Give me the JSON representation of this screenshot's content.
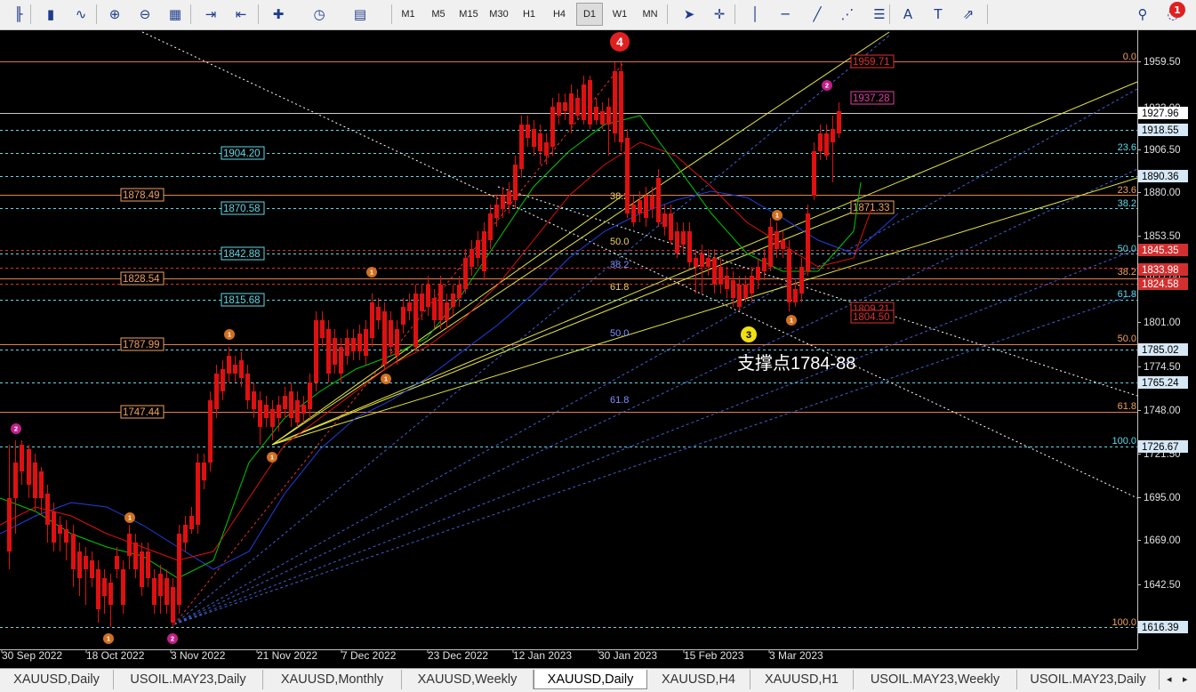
{
  "toolbar": {
    "periods": [
      "M1",
      "M5",
      "M15",
      "M30",
      "H1",
      "H4",
      "D1",
      "W1",
      "MN"
    ],
    "active_period": "D1",
    "notification_count": "1",
    "icons": [
      "bar-chart-icon",
      "candlestick-icon",
      "line-chart-icon",
      "zoom-in-icon",
      "zoom-out-icon",
      "tile-windows-icon",
      "autoscroll-icon",
      "chart-shift-icon",
      "new-order-icon",
      "clock-icon",
      "templates-icon",
      "cursor-icon",
      "crosshair-icon",
      "vertical-line-icon",
      "horizontal-line-icon",
      "trendline-icon",
      "fibonacci-fan-icon",
      "fibonacci-retracement-icon",
      "text-icon",
      "text-label-icon",
      "arrows-icon",
      "search-icon",
      "notification-icon"
    ]
  },
  "chart": {
    "annotation": "支撑点1784-88",
    "wave_labels_large": [
      "4",
      "3"
    ],
    "wave_labels_small": [
      "1",
      "2"
    ],
    "price_scale": [
      "1959.50",
      "1933.00",
      "1906.50",
      "1880.00",
      "1853.50",
      "1827.00",
      "1801.00",
      "1774.50",
      "1748.00",
      "1721.50",
      "1695.00",
      "1669.00",
      "1642.50",
      "1616.00"
    ],
    "price_tags": [
      {
        "text": "1927.96",
        "bg": "#ffffff",
        "fg": "#000000"
      },
      {
        "text": "1918.55",
        "bg": "#d6e7f5",
        "fg": "#000000"
      },
      {
        "text": "1890.36",
        "bg": "#d6e7f5",
        "fg": "#000000"
      },
      {
        "text": "1845.35",
        "bg": "#d32f2f",
        "fg": "#ffffff"
      },
      {
        "text": "1833.98",
        "bg": "#d32f2f",
        "fg": "#ffffff"
      },
      {
        "text": "1824.58",
        "bg": "#d32f2f",
        "fg": "#ffffff"
      },
      {
        "text": "1785.02",
        "bg": "#d6e7f5",
        "fg": "#000000"
      },
      {
        "text": "1765.24",
        "bg": "#d6e7f5",
        "fg": "#000000"
      },
      {
        "text": "1726.67",
        "bg": "#d6e7f5",
        "fg": "#000000"
      },
      {
        "text": "1616.39",
        "bg": "#d6e7f5",
        "fg": "#000000"
      }
    ],
    "left_level_labels": [
      "1904.20",
      "1878.49",
      "1870.58",
      "1842.88",
      "1828.54",
      "1815.68",
      "1787.99",
      "1747.44"
    ],
    "right_level_labels": [
      "1959.71",
      "1937.28",
      "1871.33",
      "1809.21",
      "1804.50"
    ],
    "fib_right": [
      "0.0",
      "23.6",
      "23.6",
      "38.2",
      "50.0",
      "38.2",
      "61.8",
      "50.0",
      "61.8",
      "100.0",
      "100.0"
    ],
    "fib_mid": [
      "38.2",
      "50.0",
      "38.2",
      "61.8",
      "50.0",
      "61.8"
    ],
    "dates": [
      "30 Sep 2022",
      "18 Oct 2022",
      "3 Nov 2022",
      "21 Nov 2022",
      "7 Dec 2022",
      "23 Dec 2022",
      "12 Jan 2023",
      "30 Jan 2023",
      "15 Feb 2023",
      "3 Mar 2023"
    ]
  },
  "tabs": [
    "XAUUSD,Daily",
    "USOIL.MAY23,Daily",
    "XAUUSD,Monthly",
    "XAUUSD,Weekly",
    "XAUUSD,Daily",
    "XAUUSD,H4",
    "XAUUSD,H1",
    "USOIL.MAY23,Weekly",
    "USOIL.MAY23,Daily"
  ],
  "active_tab": "XAUUSD,Daily",
  "colors": {
    "bull": "#00c800",
    "bear": "#e01010",
    "fib_cyan": "#5fd8e6",
    "fib_orange": "#f0a060",
    "fib_red": "#e03030",
    "ma_red": "#e01010",
    "ma_green": "#00c800",
    "ma_blue": "#2040e0",
    "trend_yellow": "#e6e640"
  }
}
